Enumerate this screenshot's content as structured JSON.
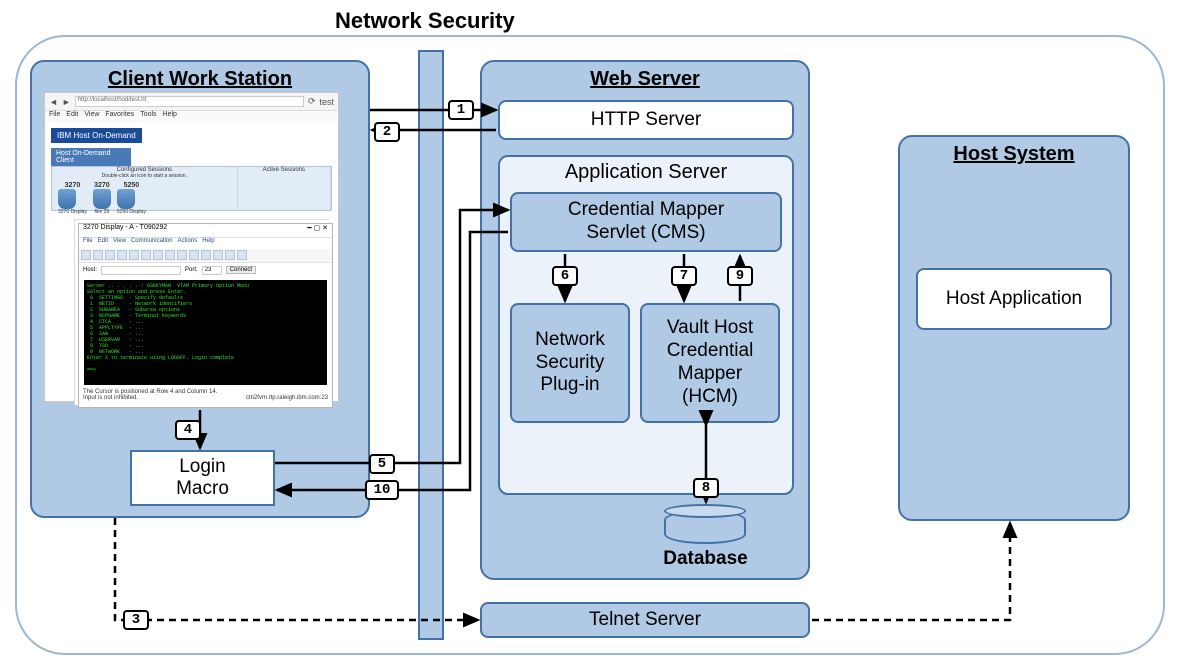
{
  "title": "Network Security",
  "client": {
    "heading": "Client Work Station",
    "browser_url": "http://localhost/hod/test.ht",
    "tab": "test",
    "menu": [
      "File",
      "Edit",
      "View",
      "Favorites",
      "Tools",
      "Help"
    ],
    "banner": "IBM Host On-Demand",
    "tab2": "Host On-Demand Client",
    "cfg_hdr": "Configured Sessions",
    "cfg_hint": "Double-click an icon to start a session.",
    "active_hdr": "Active Sessions",
    "sessions": [
      {
        "proto": "3270",
        "name": "3270 Display"
      },
      {
        "proto": "3270",
        "name": "flex 29"
      },
      {
        "proto": "5250",
        "name": "5250 Display"
      }
    ],
    "term_title": "3270 Display - A - T090292",
    "term_menu": [
      "File",
      "Edit",
      "View",
      "Communication",
      "Actions",
      "Help"
    ],
    "host_lbl": "Host:",
    "port_lbl": "Port:",
    "port_val": "23",
    "connect_btn": "Connect",
    "term_text": "Server .. . . . . : GSKKYMAN  VTAM Primary Option Menu\nSelect an option and press Enter.\n 0  SETTINGS  - Specify defaults\n 1  NETID     - Network identifiers\n 2  SUBAREA   - Subarea options\n 3  NCPNAME   - Terminal keywords\n 4  CTCA      - ...\n 5  APPLTYPE  - ...\n 6  SAW       - ...\n 7  USERVAR   - ...\n 8  TSO       - ...\n 9  NETWORK   - ...\nEnter X to terminate using LOGOFF. Login complete\n\n==>",
    "cursor_msg": "The Cursor is positioned at Row 4 and Column 14.",
    "input_msg": "Input is not inhibited.",
    "statusbar_right": "ctn2fvm.rtp.raleigh.ibm.com:23",
    "login_macro": "Login Macro"
  },
  "web": {
    "heading": "Web Server",
    "http": "HTTP Server",
    "appserver": "Application Server",
    "cms": "Credential Mapper Servlet (CMS)",
    "nsp": "Network Security Plug-in",
    "hcm": "Vault Host Credential Mapper (HCM)",
    "db": "Database"
  },
  "host": {
    "heading": "Host System",
    "app": "Host Application"
  },
  "telnet": "Telnet Server",
  "steps": {
    "s1": "1",
    "s2": "2",
    "s3": "3",
    "s4": "4",
    "s5": "5",
    "s6": "6",
    "s7": "7",
    "s8": "8",
    "s9": "9",
    "s10": "10"
  }
}
